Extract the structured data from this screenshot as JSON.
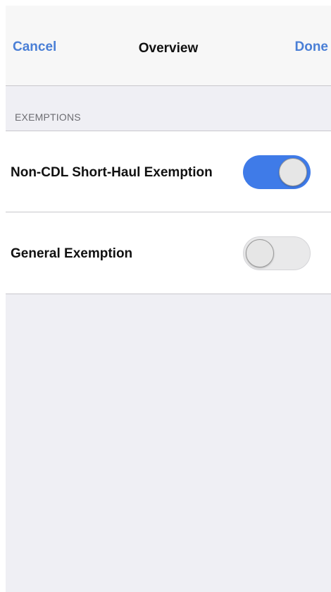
{
  "navbar": {
    "cancel_label": "Cancel",
    "title": "Overview",
    "done_label": "Done"
  },
  "section": {
    "header": "EXEMPTIONS"
  },
  "exemptions": [
    {
      "label": "Non-CDL Short-Haul Exemption",
      "enabled": true
    },
    {
      "label": "General Exemption",
      "enabled": false
    }
  ],
  "colors": {
    "accent": "#4a7fd6",
    "toggle_on": "#3f7be8",
    "background": "#efeff4"
  }
}
